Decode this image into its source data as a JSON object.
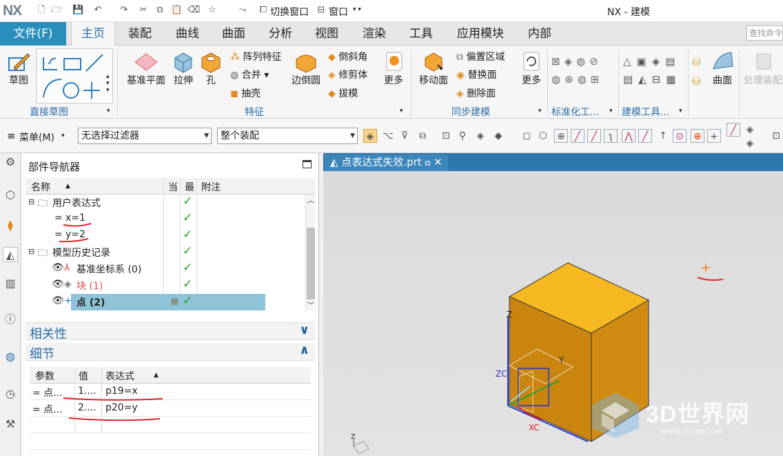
{
  "app": {
    "logo": "NX",
    "title": "NX - 建模"
  },
  "quickbar": {
    "switch_window": "切换窗口",
    "window": "窗口"
  },
  "tabs": [
    {
      "label": "文件(F)"
    },
    {
      "label": "主页"
    },
    {
      "label": "装配"
    },
    {
      "label": "曲线"
    },
    {
      "label": "曲面"
    },
    {
      "label": "分析"
    },
    {
      "label": "视图"
    },
    {
      "label": "渲染"
    },
    {
      "label": "工具"
    },
    {
      "label": "应用模块"
    },
    {
      "label": "内部"
    }
  ],
  "search": {
    "placeholder": "查找命令"
  },
  "ribbon": {
    "sketch": "草图",
    "direct_sketch_group": "直接草图",
    "datum_plane": "基准平面",
    "extrude": "拉伸",
    "hole": "孔",
    "pattern_feature": "阵列特征",
    "unite": "合并",
    "shell": "抽壳",
    "edge_blend": "边倒圆",
    "chamfer": "倒斜角",
    "trim_body": "修剪体",
    "draft": "拔模",
    "more1": "更多",
    "feature_group": "特征",
    "move_face": "移动面",
    "offset_region": "偏置区域",
    "replace_face": "替换面",
    "delete_face": "删除面",
    "more2": "更多",
    "sync_group": "同步建模",
    "std_group": "标准化工...",
    "model_tools_group": "建模工具...",
    "surface": "曲面",
    "process_assembly": "处理装配"
  },
  "toolbar": {
    "menu": "菜单(M)",
    "filter": "无选择过滤器",
    "scope": "整个装配"
  },
  "navigator": {
    "title": "部件导航器",
    "columns": {
      "name": "名称",
      "current": "当",
      "latest": "最",
      "note": "附注"
    },
    "rows": [
      {
        "label": "用户表达式"
      },
      {
        "label": "x=1"
      },
      {
        "label": "y=2"
      },
      {
        "label": "模型历史记录"
      },
      {
        "label": "基准坐标系 (0)"
      },
      {
        "label": "块 (1)"
      },
      {
        "label": "点 (2)"
      }
    ],
    "dependencies": "相关性",
    "details": "细节",
    "detail_columns": {
      "param": "参数",
      "value": "值",
      "expression": "表达式"
    },
    "detail_rows": [
      {
        "param": "= 点...",
        "value": "1....",
        "expression": "p19=x"
      },
      {
        "param": "= 点...",
        "value": "2....",
        "expression": "p20=y"
      }
    ]
  },
  "viewport": {
    "tab": "点表达式失效.prt",
    "axis_labels": {
      "z": "Z",
      "y": "Y",
      "zc": "ZC",
      "xc": "XC",
      "mini_z": "Z"
    }
  },
  "watermark": {
    "text": "3D世界网",
    "url": "WWW.3DSJW.COM"
  },
  "colors": {
    "accent": "#2b8fbd",
    "cube_top": "#f6b820",
    "cube_front": "#c98510",
    "cube_side": "#d08a12",
    "check": "#1f9e2a",
    "annotation": "#e0222a"
  }
}
